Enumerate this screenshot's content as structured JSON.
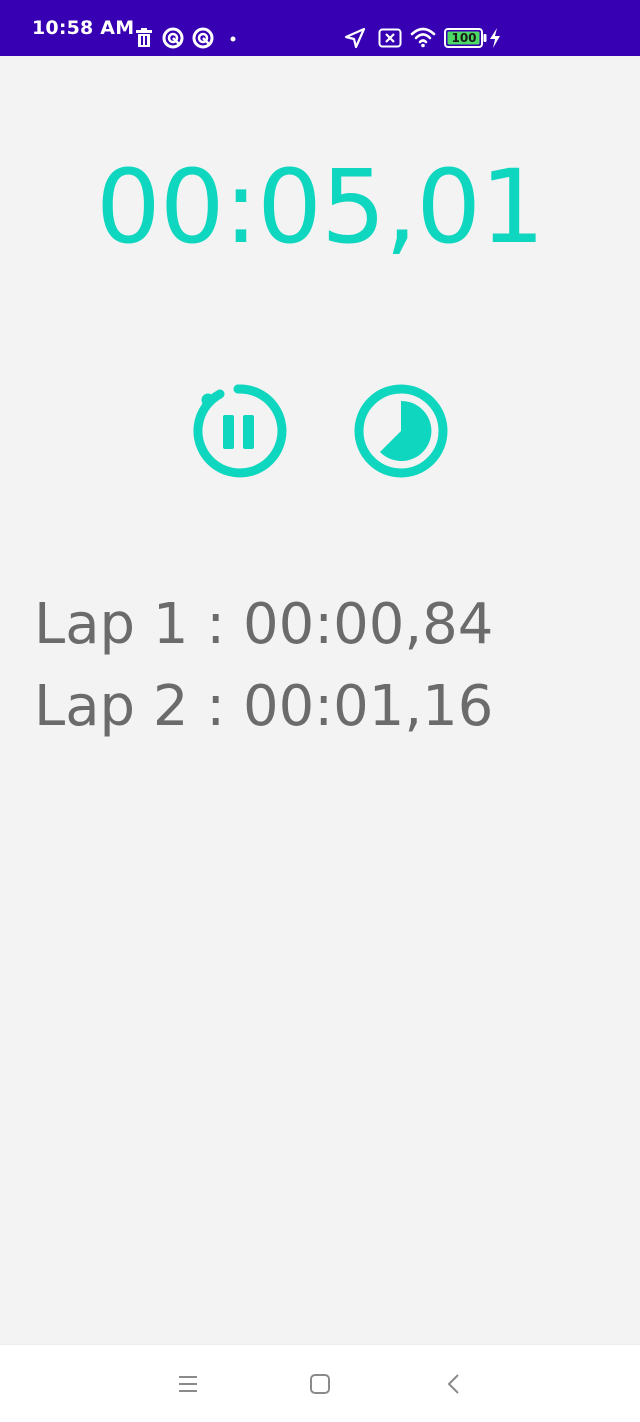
{
  "status_bar": {
    "time": "10:58 AM",
    "battery_level": "100",
    "background_color": "#3700b3",
    "icons": [
      "trash-icon",
      "app-ring-icon",
      "app-ring-icon",
      "dot-icon",
      "location-arrow-icon",
      "sim-off-icon",
      "wifi-icon",
      "battery-icon",
      "charging-bolt-icon"
    ]
  },
  "stopwatch": {
    "time": "00:05,01",
    "accent_color": "#0fd6be",
    "controls": {
      "pause_icon": "pause-icon",
      "lap_icon": "lap-timer-icon"
    },
    "laps": [
      {
        "label": "Lap 1",
        "separator": " : ",
        "time": "00:00,84"
      },
      {
        "label": "Lap 2",
        "separator": " : ",
        "time": "00:01,16"
      }
    ]
  },
  "nav_bar": {
    "icons": [
      "menu-icon",
      "home-icon",
      "back-icon"
    ]
  }
}
